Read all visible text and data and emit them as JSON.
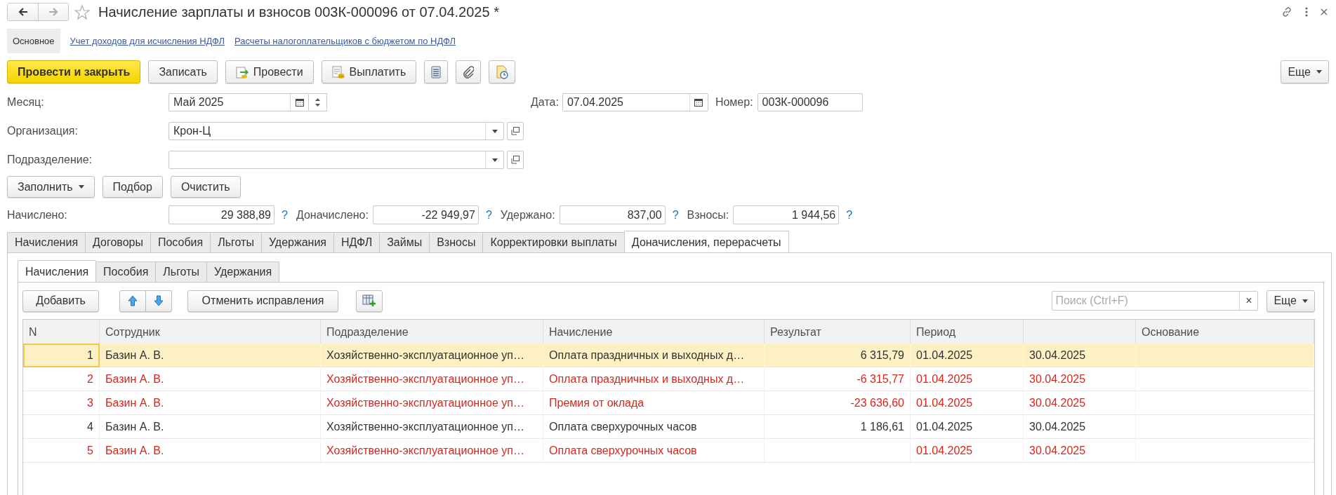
{
  "window": {
    "title": "Начисление зарплаты и взносов 003К-000096 от 07.04.2025 *"
  },
  "sections": [
    {
      "label": "Основное",
      "selected": true
    },
    {
      "label": "Учет доходов для исчисления НДФЛ",
      "selected": false
    },
    {
      "label": "Расчеты налогоплательщиков с бюджетом по НДФЛ",
      "selected": false
    }
  ],
  "toolbar": {
    "buttons": [
      {
        "label": "Провести и закрыть",
        "kind": "primary"
      },
      {
        "label": "Записать",
        "kind": "plain"
      },
      {
        "label": "Провести",
        "kind": "post"
      },
      {
        "label": "Выплатить",
        "kind": "pay"
      },
      {
        "kind": "list"
      },
      {
        "kind": "clip"
      },
      {
        "kind": "report"
      }
    ],
    "more": "Еще"
  },
  "fields": {
    "month": {
      "label": "Месяц:",
      "value": "Май 2025"
    },
    "date": {
      "label": "Дата:",
      "value": "07.04.2025"
    },
    "number": {
      "label": "Номер:",
      "value": "003К-000096"
    },
    "organization": {
      "label": "Организация:",
      "value": "Крон-Ц"
    },
    "department": {
      "label": "Подразделение:"
    }
  },
  "fill_buttons": [
    {
      "label": "Заполнить",
      "dropdown": true
    },
    {
      "label": "Подбор",
      "dropdown": false
    },
    {
      "label": "Очистить",
      "dropdown": false
    }
  ],
  "totals": [
    {
      "label": "Начислено:",
      "value": "29 388,89",
      "help": "?"
    },
    {
      "label": "Доначислено:",
      "value": "-22 949,97",
      "help": "?"
    },
    {
      "label": "Удержано:",
      "value": "837,00",
      "help": "?"
    },
    {
      "label": "Взносы:",
      "value": "1 944,56",
      "help": "?"
    }
  ],
  "tabs": [
    {
      "label": "Начисления",
      "selected": false
    },
    {
      "label": "Договоры",
      "selected": false
    },
    {
      "label": "Пособия",
      "selected": false
    },
    {
      "label": "Льготы",
      "selected": false
    },
    {
      "label": "Удержания",
      "selected": false
    },
    {
      "label": "НДФЛ",
      "selected": false
    },
    {
      "label": "Займы",
      "selected": false
    },
    {
      "label": "Взносы",
      "selected": false
    },
    {
      "label": "Корректировки выплаты",
      "selected": false
    },
    {
      "label": "Доначисления, перерасчеты",
      "selected": true
    }
  ],
  "subtabs": [
    {
      "label": "Начисления",
      "selected": true
    },
    {
      "label": "Пособия",
      "selected": false
    },
    {
      "label": "Льготы",
      "selected": false
    },
    {
      "label": "Удержания",
      "selected": false
    }
  ],
  "table_toolbar": {
    "add": "Добавить",
    "cancel": "Отменить исправления",
    "search": {
      "placeholder": "Поиск (Ctrl+F)",
      "clear": "×"
    },
    "more": "Еще"
  },
  "table": {
    "columns": [
      {
        "label": "N"
      },
      {
        "label": "Сотрудник"
      },
      {
        "label": "Подразделение"
      },
      {
        "label": "Начисление"
      },
      {
        "label": "Результат"
      },
      {
        "label": "Период"
      },
      {},
      {
        "label": "Основание"
      }
    ],
    "rows": [
      {
        "n": "1",
        "employee": "Базин А. В.",
        "department": "Хозяйственно-эксплуатационное уп…",
        "accrual": "Оплата праздничных и выходных д…",
        "result": "6 315,79",
        "period_start": "01.04.2025",
        "period_end": "30.04.2025",
        "selected": true,
        "corrected": false
      },
      {
        "n": "2",
        "employee": "Базин А. В.",
        "department": "Хозяйственно-эксплуатационное уп…",
        "accrual": "Оплата праздничных и выходных д…",
        "result": "-6 315,77",
        "period_start": "01.04.2025",
        "period_end": "30.04.2025",
        "selected": false,
        "corrected": true
      },
      {
        "n": "3",
        "employee": "Базин А. В.",
        "department": "Хозяйственно-эксплуатационное уп…",
        "accrual": "Премия от оклада",
        "result": "-23 636,60",
        "period_start": "01.04.2025",
        "period_end": "30.04.2025",
        "selected": false,
        "corrected": true
      },
      {
        "n": "4",
        "employee": "Базин А. В.",
        "department": "Хозяйственно-эксплуатационное уп…",
        "accrual": "Оплата сверхурочных часов",
        "result": "1 186,61",
        "period_start": "01.04.2025",
        "period_end": "30.04.2025",
        "selected": false,
        "corrected": false
      },
      {
        "n": "5",
        "employee": "Базин А. В.",
        "department": "Хозяйственно-эксплуатационное уп…",
        "accrual": "Оплата сверхурочных часов",
        "period_start": "01.04.2025",
        "period_end": "30.04.2025",
        "selected": false,
        "corrected": true
      }
    ]
  }
}
